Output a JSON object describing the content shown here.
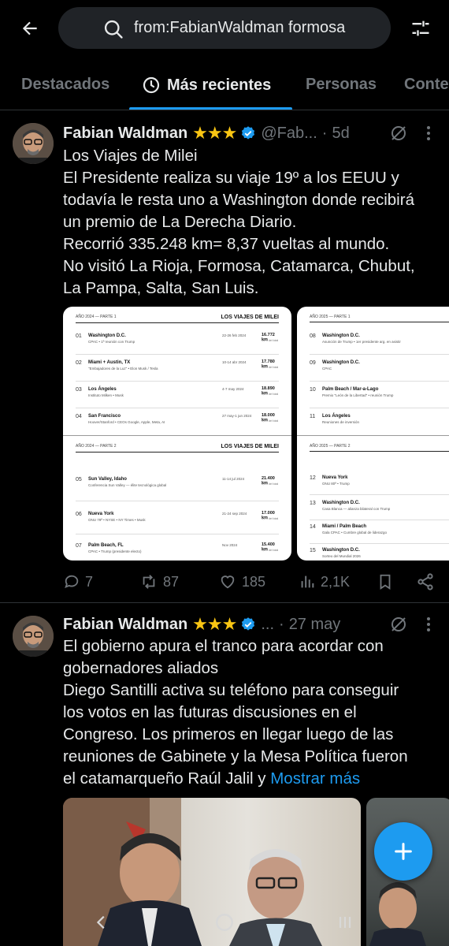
{
  "search": {
    "query": "from:FabianWaldman formosa"
  },
  "tabs": [
    {
      "label": "Destacados"
    },
    {
      "label": "Más recientes"
    },
    {
      "label": "Personas"
    },
    {
      "label": "Conte"
    }
  ],
  "tweets": [
    {
      "author": "Fabian Waldman",
      "stars": "★★★",
      "handle": "@Fab...",
      "time": "5d",
      "lines": [
        "Los Viajes de Milei",
        "El Presidente realiza su viaje 19º a los EEUU y",
        "todavía le resta uno a Washington donde recibirá",
        "un premio de La Derecha Diario.",
        "Recorrió 335.248 km= 8,37 vueltas al mundo.",
        "No visitó La Rioja, Formosa, Catamarca, Chubut,",
        "La Pampa, Salta, San Luis."
      ],
      "doc": {
        "title": "LOS VIAJES DE MILEI",
        "part1_label": "AÑO 2024 — PARTE 1",
        "part2_label": "AÑO 2024 — PARTE 2",
        "part3_label": "AÑO 2025 — PARTE 1",
        "part4_label": "AÑO 2025 — PARTE 2",
        "trips1": [
          {
            "num": "01",
            "city": "Washington D.C.",
            "note": "CPAC • 1ª reunión con Trump",
            "date": "22-26 feb 2024",
            "km": "16.772 km",
            "sub": "5,2% del total"
          },
          {
            "num": "02",
            "city": "Miami + Austin, TX",
            "note": "\"Embajadores de la Luz\" • Elon Musk / Tesla",
            "date": "10-14 abr 2024",
            "km": "17.780 km",
            "sub": "5,3% del total"
          },
          {
            "num": "03",
            "city": "Los Ángeles",
            "note": "Instituto Milken • Musk",
            "date": "4-7 may 2024",
            "km": "18.890 km",
            "sub": "5,6% del total"
          },
          {
            "num": "04",
            "city": "San Francisco",
            "note": "Hoover/Stanford • CEOs Google, Apple, Meta, AI",
            "date": "27 may-1 jun 2024",
            "km": "18.000 km",
            "sub": "5,4% del total"
          }
        ],
        "trips2": [
          {
            "num": "05",
            "city": "Sun Valley, Idaho",
            "note": "Conferencia Sun Valley — élite tecnológica global",
            "date": "11-14 jul 2024",
            "km": "21.400 km",
            "sub": "6,4% del total"
          },
          {
            "num": "06",
            "city": "Nueva York",
            "note": "ONU 79ª • NYSE • NY Times • Musk",
            "date": "21-24 sep 2024",
            "km": "17.000 km",
            "sub": "5,1% del total"
          },
          {
            "num": "07",
            "city": "Palm Beach, FL",
            "note": "CPAC • Trump (presidente electo)",
            "date": "Nov 2024",
            "km": "15.400 km",
            "sub": "4,6% del total"
          }
        ],
        "trips3": [
          {
            "num": "08",
            "city": "Washington D.C.",
            "note": "Asunción de Trump • 1er presidente arg. en asistir"
          },
          {
            "num": "09",
            "city": "Washington D.C.",
            "note": "CPAC"
          },
          {
            "num": "10",
            "city": "Palm Beach / Mar-a-Lago",
            "note": "Premio \"León de la Libertad\" • reunión Trump"
          },
          {
            "num": "11",
            "city": "Los Ángeles",
            "note": "Reuniones de inversión"
          }
        ],
        "trips4": [
          {
            "num": "12",
            "city": "Nueva York",
            "note": "ONU 80ª • Trump"
          },
          {
            "num": "13",
            "city": "Washington D.C.",
            "note": "Casa Blanca — alianza bilateral con Trump"
          },
          {
            "num": "14",
            "city": "Miami / Palm Beach",
            "note": "Gala CPAC • Cumbre global de liderazgo"
          },
          {
            "num": "15",
            "city": "Washington D.C.",
            "note": "Sorteo del Mundial 2026"
          }
        ]
      },
      "replies": "7",
      "reposts": "87",
      "likes": "185",
      "views": "2,1K"
    },
    {
      "author": "Fabian Waldman",
      "stars": "★★★",
      "handle": "...",
      "time": "27 may",
      "lines": [
        "El gobierno apura el tranco para acordar con",
        "gobernadores aliados",
        "Diego Santilli activa su teléfono para conseguir",
        "los votos en las futuras discusiones en el",
        "Congreso. Los primeros en llegar luego de las",
        "reuniones de Gabinete y la Mesa Política fueron",
        "el catamarqueño Raúl Jalil y "
      ],
      "show_more": "Mostrar más"
    }
  ],
  "icons": {
    "back": "arrow-left-icon",
    "search": "search-icon",
    "filter": "sliders-icon",
    "clock": "clock-icon",
    "verified": "verified-badge-icon",
    "grok": "grok-icon",
    "more": "more-vertical-icon",
    "reply": "reply-icon",
    "repost": "repost-icon",
    "like": "heart-icon",
    "views": "views-icon",
    "bookmark": "bookmark-icon",
    "share": "share-icon",
    "compose": "plus-icon"
  },
  "colors": {
    "accent": "#1d9bf0",
    "background": "#000000",
    "muted": "#71767b",
    "stars": "#f9c513"
  }
}
